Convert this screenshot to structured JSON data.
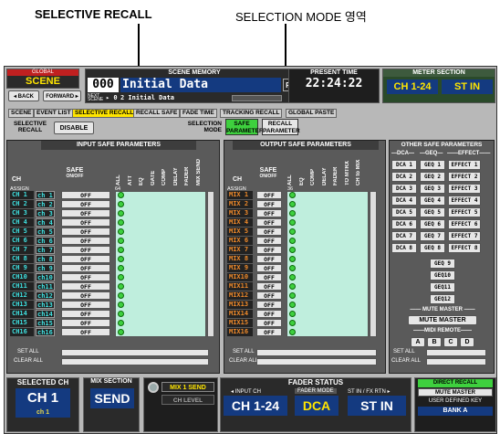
{
  "annotations": {
    "left": "SELECTIVE RECALL",
    "right": "SELECTION MODE 영역"
  },
  "header": {
    "global_label": "GLOBAL",
    "scene_label": "SCENE",
    "back_label": "◂ BACK",
    "forward_label": "FORWARD ▸",
    "scene_memory_label": "SCENE MEMORY",
    "scene_number": "000",
    "scene_title": "Initial Data",
    "r_flag": "R",
    "next_label": "NEXT SCENE",
    "next_arrow": "▸ 0",
    "next_title": "2 Initial Data",
    "present_time_label": "PRESENT TIME",
    "time": "22:24:22",
    "meter_label": "METER SECTION",
    "meter_ch": "CH 1-24",
    "meter_st": "ST IN"
  },
  "tabs": [
    "SCENE",
    "EVENT LIST",
    "SELECTIVE RECALL",
    "RECALL SAFE",
    "FADE TIME",
    "TRACKING RECALL",
    "GLOBAL PASTE"
  ],
  "selective": {
    "label": "SELECTIVE RECALL",
    "disable": "DISABLE",
    "mode_label": "SELECTION MODE",
    "safe_param": "SAFE PARAMETER",
    "recall_param": "RECALL PARAMETER"
  },
  "input_panel": {
    "title": "INPUT SAFE PARAMETERS",
    "ch_label": "CH",
    "safe_label": "SAFE",
    "onoff": "ON/OFF",
    "assign": "ASSIGN",
    "count": "64",
    "cols": [
      "ALL",
      "ATT",
      "EQ",
      "GATE",
      "COMP",
      "DELAY",
      "FADER",
      "MIX SEND"
    ],
    "rows": [
      {
        "ch": "CH 1",
        "name": "ch 1",
        "state": "OFF"
      },
      {
        "ch": "CH 2",
        "name": "ch 2",
        "state": "OFF"
      },
      {
        "ch": "CH 3",
        "name": "ch 3",
        "state": "OFF"
      },
      {
        "ch": "CH 4",
        "name": "ch 4",
        "state": "OFF"
      },
      {
        "ch": "CH 5",
        "name": "ch 5",
        "state": "OFF"
      },
      {
        "ch": "CH 6",
        "name": "ch 6",
        "state": "OFF"
      },
      {
        "ch": "CH 7",
        "name": "ch 7",
        "state": "OFF"
      },
      {
        "ch": "CH 8",
        "name": "ch 8",
        "state": "OFF"
      },
      {
        "ch": "CH 9",
        "name": "ch 9",
        "state": "OFF"
      },
      {
        "ch": "CH10",
        "name": "ch10",
        "state": "OFF"
      },
      {
        "ch": "CH11",
        "name": "ch11",
        "state": "OFF"
      },
      {
        "ch": "CH12",
        "name": "ch12",
        "state": "OFF"
      },
      {
        "ch": "CH13",
        "name": "ch13",
        "state": "OFF"
      },
      {
        "ch": "CH14",
        "name": "ch14",
        "state": "OFF"
      },
      {
        "ch": "CH15",
        "name": "ch15",
        "state": "OFF"
      },
      {
        "ch": "CH16",
        "name": "ch16",
        "state": "OFF"
      }
    ],
    "set_all": "SET ALL",
    "clear_all": "CLEAR ALL"
  },
  "output_panel": {
    "title": "OUTPUT SAFE PARAMETERS",
    "ch_label": "CH",
    "safe_label": "SAFE",
    "onoff": "ON/OFF",
    "assign": "ASSIGN",
    "count": "36",
    "cols": [
      "ALL",
      "EQ",
      "COMP",
      "DELAY",
      "FADER",
      "TO MTRX",
      "CH to MIX"
    ],
    "rows": [
      {
        "ch": "MIX 1",
        "state": "OFF"
      },
      {
        "ch": "MIX 2",
        "state": "OFF"
      },
      {
        "ch": "MIX 3",
        "state": "OFF"
      },
      {
        "ch": "MIX 4",
        "state": "OFF"
      },
      {
        "ch": "MIX 5",
        "state": "OFF"
      },
      {
        "ch": "MIX 6",
        "state": "OFF"
      },
      {
        "ch": "MIX 7",
        "state": "OFF"
      },
      {
        "ch": "MIX 8",
        "state": "OFF"
      },
      {
        "ch": "MIX 9",
        "state": "OFF"
      },
      {
        "ch": "MIX10",
        "state": "OFF"
      },
      {
        "ch": "MIX11",
        "state": "OFF"
      },
      {
        "ch": "MIX12",
        "state": "OFF"
      },
      {
        "ch": "MIX13",
        "state": "OFF"
      },
      {
        "ch": "MIX14",
        "state": "OFF"
      },
      {
        "ch": "MIX15",
        "state": "OFF"
      },
      {
        "ch": "MIX16",
        "state": "OFF"
      }
    ],
    "set_all": "SET ALL",
    "clear_all": "CLEAR ALL"
  },
  "other_panel": {
    "title": "OTHER SAFE PARAMETERS",
    "head_dca": "—DCA—",
    "head_geq": "—GEQ—",
    "head_effect": "——EFFECT——",
    "rows": [
      {
        "dca": "DCA 1",
        "geq": "GEQ 1",
        "effect": "EFFECT 1"
      },
      {
        "dca": "DCA 2",
        "geq": "GEQ 2",
        "effect": "EFFECT 2"
      },
      {
        "dca": "DCA 3",
        "geq": "GEQ 3",
        "effect": "EFFECT 3"
      },
      {
        "dca": "DCA 4",
        "geq": "GEQ 4",
        "effect": "EFFECT 4"
      },
      {
        "dca": "DCA 5",
        "geq": "GEQ 5",
        "effect": "EFFECT 5"
      },
      {
        "dca": "DCA 6",
        "geq": "GEQ 6",
        "effect": "EFFECT 6"
      },
      {
        "dca": "DCA 7",
        "geq": "GEQ 7",
        "effect": "EFFECT 7"
      },
      {
        "dca": "DCA 8",
        "geq": "GEQ 8",
        "effect": "EFFECT 8"
      }
    ],
    "geq_extra": [
      "GEQ 9",
      "GEQ10",
      "GEQ11",
      "GEQ12"
    ],
    "mute_head": "—— MUTE MASTER ——",
    "mute_btn": "MUTE MASTER",
    "midi_head": "——MIDI REMOTE——",
    "midi_btns": [
      "A",
      "B",
      "C",
      "D"
    ],
    "set_all": "SET ALL",
    "clear_all": "CLEAR ALL"
  },
  "footer": {
    "selected_ch_label": "SELECTED CH",
    "selected_ch": "CH 1",
    "selected_ch_name": "ch 1",
    "mix_section_label": "MIX SECTION",
    "mix_section": "SEND",
    "mix_send": "MIX 1 SEND",
    "ch_level": "CH LEVEL",
    "fader_status_label": "FADER STATUS",
    "input_ch_label": "◂ INPUT CH",
    "input_ch": "CH 1-24",
    "fader_mode_label": "FADER MODE",
    "fader_mode": "DCA",
    "stin_label": "ST IN / FX RTN ▸",
    "stin": "ST IN",
    "direct_recall": "DIRECT RECALL",
    "mute_master": "MUTE MASTER",
    "user_key_label": "USER DEFINED KEY",
    "bank": "BANK A"
  },
  "colors": {
    "accent": "#ffe500",
    "lcd": "#143a80",
    "green": "#3ed03e",
    "cyan": "#3fe0e0",
    "orange": "#f08a2a"
  }
}
